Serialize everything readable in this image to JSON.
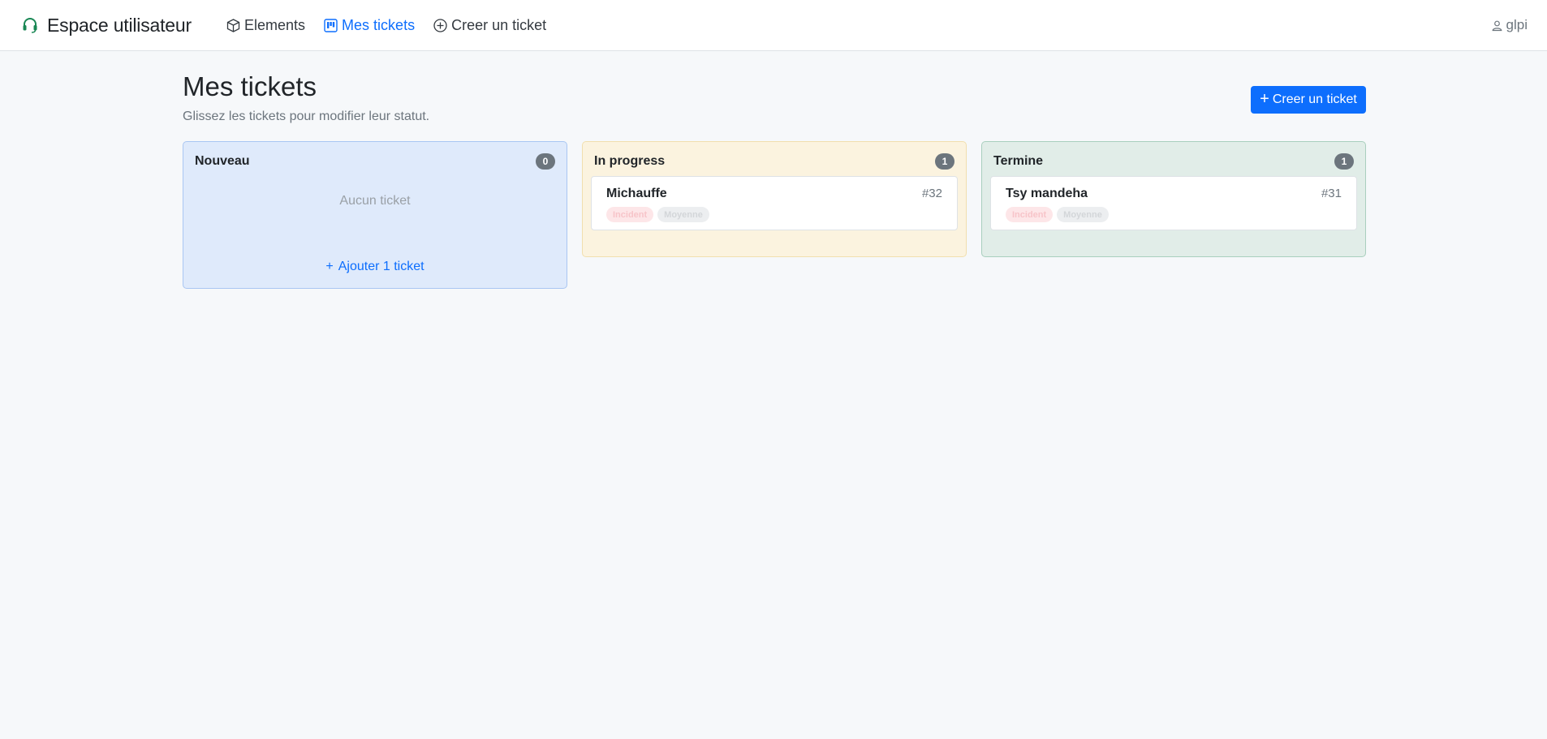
{
  "header": {
    "brand": "Espace utilisateur",
    "nav": [
      {
        "label": "Elements",
        "icon": "box-icon"
      },
      {
        "label": "Mes tickets",
        "icon": "kanban-icon",
        "active": true
      },
      {
        "label": "Creer un ticket",
        "icon": "plus-circle-icon"
      }
    ],
    "user": "glpi"
  },
  "page": {
    "title": "Mes tickets",
    "subtitle": "Glissez les tickets pour modifier leur statut.",
    "create_button": "Creer un ticket"
  },
  "columns": [
    {
      "title": "Nouveau",
      "count": "0",
      "empty_text": "Aucun ticket",
      "add_label": "Ajouter 1 ticket",
      "color": "#dfeafb"
    },
    {
      "title": "In progress",
      "count": "1",
      "color": "#fbf3df",
      "tickets": [
        {
          "name": "Michauffe",
          "id": "#32",
          "type": "Incident",
          "priority": "Moyenne"
        }
      ]
    },
    {
      "title": "Termine",
      "count": "1",
      "color": "#e1ede8",
      "tickets": [
        {
          "name": "Tsy mandeha",
          "id": "#31",
          "type": "Incident",
          "priority": "Moyenne"
        }
      ]
    }
  ],
  "colors": {
    "accent": "#0d6efd",
    "badge": "#6c757d"
  }
}
